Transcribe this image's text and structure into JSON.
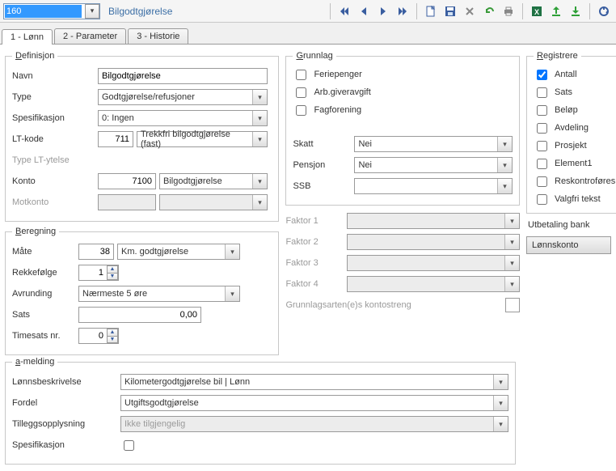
{
  "header": {
    "id_value": "160",
    "title": "Bilgodtgjørelse"
  },
  "tabs": [
    "1 - Lønn",
    "2 - Parameter",
    "3 - Historie"
  ],
  "definisjon": {
    "legend": "Definisjon",
    "navn_label": "Navn",
    "navn_value": "Bilgodtgjørelse",
    "type_label": "Type",
    "type_value": "Godtgjørelse/refusjoner",
    "spes_label": "Spesifikasjon",
    "spes_value": "0: Ingen",
    "lt_label": "LT-kode",
    "lt_code": "711",
    "lt_text": "Trekkfri bilgodtgjørelse (fast)",
    "lt_ytelse_label": "Type LT-ytelse",
    "konto_label": "Konto",
    "konto_code": "7100",
    "konto_text": "Bilgodtgjørelse",
    "motkonto_label": "Motkonto"
  },
  "beregning": {
    "legend": "Beregning",
    "mate_label": "Måte",
    "mate_code": "38",
    "mate_text": "Km. godtgjørelse",
    "rekke_label": "Rekkefølge",
    "rekke_value": "1",
    "avrunding_label": "Avrunding",
    "avrunding_value": "Nærmeste  5 øre",
    "sats_label": "Sats",
    "sats_value": "0,00",
    "timesats_label": "Timesats nr.",
    "timesats_value": "0"
  },
  "grunnlag": {
    "legend": "Grunnlag",
    "feriepenger": "Feriepenger",
    "arbgiver": "Arb.giveravgift",
    "fagforening": "Fagforening",
    "skatt_label": "Skatt",
    "skatt_value": "Nei",
    "pensjon_label": "Pensjon",
    "pensjon_value": "Nei",
    "ssb_label": "SSB",
    "ssb_value": ""
  },
  "faktor": {
    "f1": "Faktor 1",
    "f2": "Faktor 2",
    "f3": "Faktor 3",
    "f4": "Faktor 4",
    "gk": "Grunnlagsarten(e)s kontostreng"
  },
  "registrere": {
    "legend": "Registrere",
    "antall": "Antall",
    "sats": "Sats",
    "belop": "Beløp",
    "avdeling": "Avdeling",
    "prosjekt": "Prosjekt",
    "element1": "Element1",
    "reskontro": "Reskontroføres",
    "valgfri": "Valgfri tekst"
  },
  "bank": {
    "head": "Utbetaling bank",
    "btn": "Lønnskonto"
  },
  "amelding": {
    "legend": "a-melding",
    "lonns_label": "Lønnsbeskrivelse",
    "lonns_value": "Kilometergodtgjørelse bil | Lønn",
    "fordel_label": "Fordel",
    "fordel_value": "Utgiftsgodtgjørelse",
    "tillegg_label": "Tilleggsopplysning",
    "tillegg_value": "Ikke tilgjengelig",
    "spes_label": "Spesifikasjon"
  }
}
